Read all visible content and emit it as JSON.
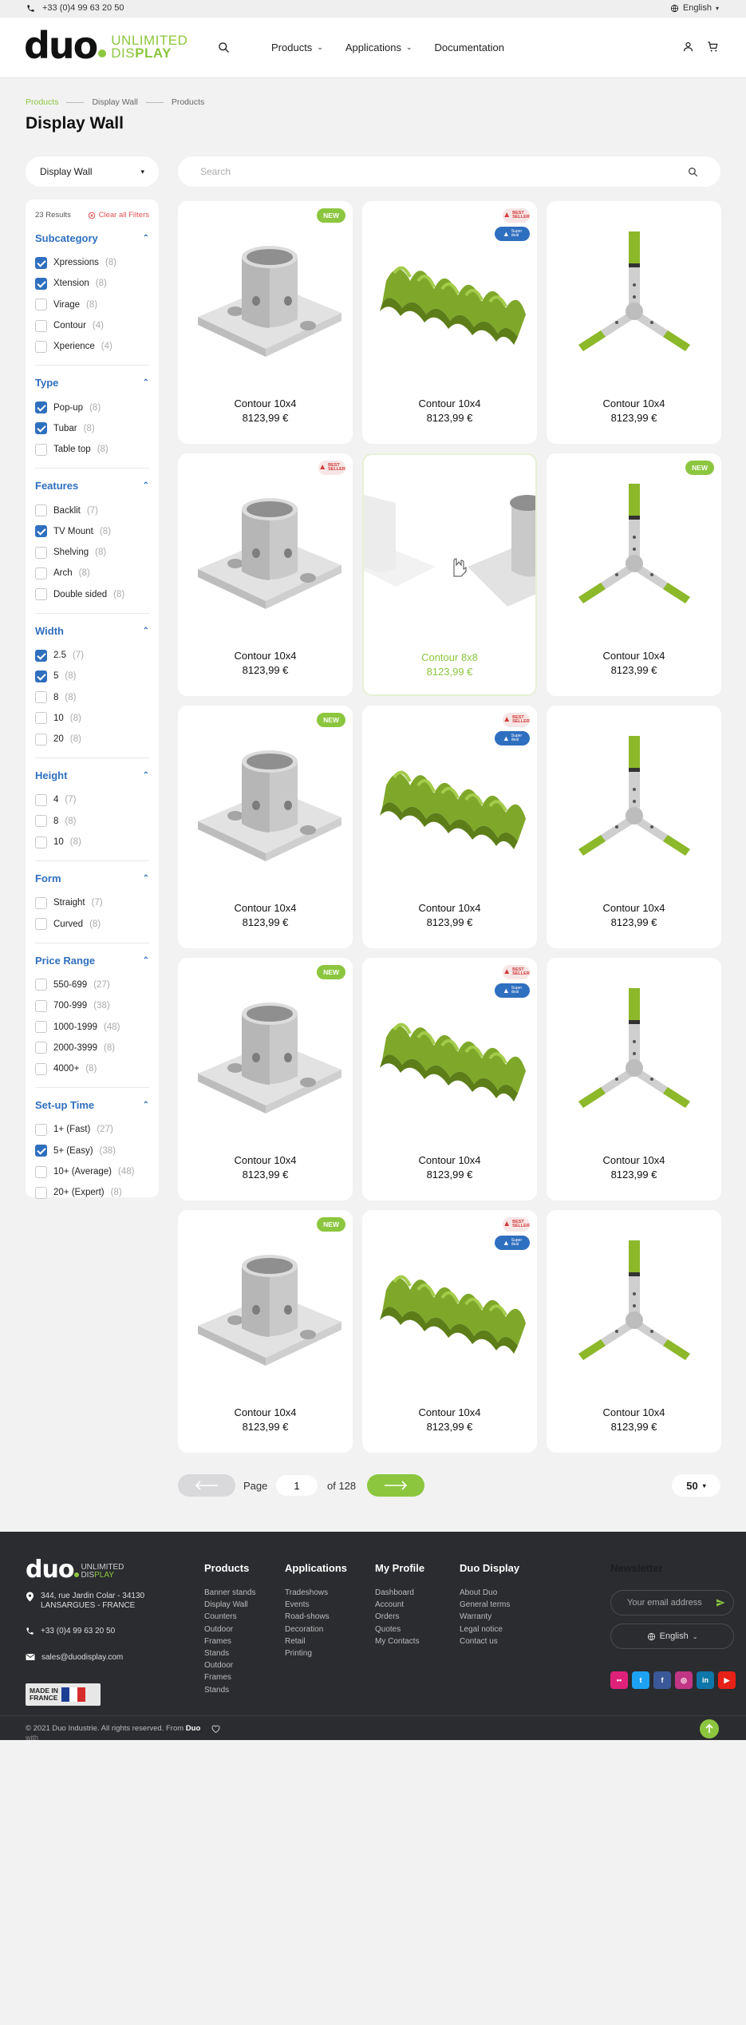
{
  "topbar": {
    "phone": "+33 (0)4 99 63 20 50",
    "language": "English"
  },
  "header": {
    "logo_main": "duo",
    "logo_line1": "UNLIMITED",
    "logo_line2a": "DIS",
    "logo_line2b": "PLAY",
    "nav": [
      {
        "label": "Products",
        "has_dropdown": true
      },
      {
        "label": "Applications",
        "has_dropdown": true
      },
      {
        "label": "Documentation",
        "has_dropdown": false
      }
    ]
  },
  "breadcrumb": [
    "Products",
    "Display Wall",
    "Products"
  ],
  "page_title": "Display Wall",
  "category_select": "Display Wall",
  "search": {
    "placeholder": "Search"
  },
  "sidebar": {
    "results": "23 Results",
    "clear": "Clear all Filters",
    "groups": [
      {
        "title": "Subcategory",
        "options": [
          {
            "label": "Xpressions",
            "count": "(8)",
            "checked": true
          },
          {
            "label": "Xtension",
            "count": "(8)",
            "checked": true
          },
          {
            "label": "Virage",
            "count": "(8)",
            "checked": false
          },
          {
            "label": "Contour",
            "count": "(4)",
            "checked": false
          },
          {
            "label": "Xperience",
            "count": "(4)",
            "checked": false
          }
        ]
      },
      {
        "title": "Type",
        "options": [
          {
            "label": "Pop-up",
            "count": "(8)",
            "checked": true
          },
          {
            "label": "Tubar",
            "count": "(8)",
            "checked": true
          },
          {
            "label": "Table top",
            "count": "(8)",
            "checked": false
          }
        ]
      },
      {
        "title": "Features",
        "options": [
          {
            "label": "Backlit",
            "count": "(7)",
            "checked": false
          },
          {
            "label": "TV Mount",
            "count": "(8)",
            "checked": true
          },
          {
            "label": "Shelving",
            "count": "(8)",
            "checked": false
          },
          {
            "label": "Arch",
            "count": "(8)",
            "checked": false
          },
          {
            "label": "Double sided",
            "count": "(8)",
            "checked": false
          }
        ]
      },
      {
        "title": "Width",
        "options": [
          {
            "label": "2.5",
            "count": "(7)",
            "checked": true
          },
          {
            "label": "5",
            "count": "(8)",
            "checked": true
          },
          {
            "label": "8",
            "count": "(8)",
            "checked": false
          },
          {
            "label": "10",
            "count": "(8)",
            "checked": false
          },
          {
            "label": "20",
            "count": "(8)",
            "checked": false
          }
        ]
      },
      {
        "title": "Height",
        "options": [
          {
            "label": "4",
            "count": "(7)",
            "checked": false
          },
          {
            "label": "8",
            "count": "(8)",
            "checked": false
          },
          {
            "label": "10",
            "count": "(8)",
            "checked": false
          }
        ]
      },
      {
        "title": "Form",
        "options": [
          {
            "label": "Straight",
            "count": "(7)",
            "checked": false
          },
          {
            "label": "Curved",
            "count": "(8)",
            "checked": false
          }
        ]
      },
      {
        "title": "Price Range",
        "options": [
          {
            "label": "550-699",
            "count": "(27)",
            "checked": false
          },
          {
            "label": "700-999",
            "count": "(38)",
            "checked": false
          },
          {
            "label": "1000-1999",
            "count": "(48)",
            "checked": false
          },
          {
            "label": "2000-3999",
            "count": "(8)",
            "checked": false
          },
          {
            "label": "4000+",
            "count": "(8)",
            "checked": false
          }
        ]
      },
      {
        "title": "Set-up Time",
        "options": [
          {
            "label": "1+ (Fast)",
            "count": "(27)",
            "checked": false
          },
          {
            "label": "5+ (Easy)",
            "count": "(38)",
            "checked": true
          },
          {
            "label": "10+ (Average)",
            "count": "(48)",
            "checked": false
          },
          {
            "label": "20+ (Expert)",
            "count": "(8)",
            "checked": false
          }
        ]
      }
    ]
  },
  "products": [
    {
      "name": "Contour 10x4",
      "price": "8123,99 €",
      "image": "foot-base",
      "badge": "new"
    },
    {
      "name": "Contour 10x4",
      "price": "8123,99 €",
      "image": "green-wave",
      "badge": "best-super"
    },
    {
      "name": "Contour 10x4",
      "price": "8123,99 €",
      "image": "connector",
      "badge": ""
    },
    {
      "name": "Contour 10x4",
      "price": "8123,99 €",
      "image": "foot-base",
      "badge": "best"
    },
    {
      "name": "Contour 8x8",
      "price": "8123,99 €",
      "image": "foot-slide",
      "badge": "",
      "hovered": true
    },
    {
      "name": "Contour 10x4",
      "price": "8123,99 €",
      "image": "connector",
      "badge": "new"
    },
    {
      "name": "Contour 10x4",
      "price": "8123,99 €",
      "image": "foot-base",
      "badge": "new"
    },
    {
      "name": "Contour 10x4",
      "price": "8123,99 €",
      "image": "green-wave",
      "badge": "best-super"
    },
    {
      "name": "Contour 10x4",
      "price": "8123,99 €",
      "image": "connector",
      "badge": ""
    },
    {
      "name": "Contour 10x4",
      "price": "8123,99 €",
      "image": "foot-base",
      "badge": "new"
    },
    {
      "name": "Contour 10x4",
      "price": "8123,99 €",
      "image": "green-wave",
      "badge": "best-super"
    },
    {
      "name": "Contour 10x4",
      "price": "8123,99 €",
      "image": "connector",
      "badge": ""
    },
    {
      "name": "Contour 10x4",
      "price": "8123,99 €",
      "image": "foot-base",
      "badge": "new"
    },
    {
      "name": "Contour 10x4",
      "price": "8123,99 €",
      "image": "green-wave",
      "badge": "best-super"
    },
    {
      "name": "Contour 10x4",
      "price": "8123,99 €",
      "image": "connector",
      "badge": ""
    }
  ],
  "badges": {
    "new": "NEW",
    "best1": "BEST",
    "best2": "SELLER",
    "super1": "Super",
    "super2": "deal"
  },
  "pagination": {
    "page_label": "Page",
    "current": "1",
    "of_label": "of 128",
    "per_page": "50"
  },
  "footer": {
    "logo_main": "duo",
    "logo_sub1": "UNLIMITED",
    "logo_sub2a": "DIS",
    "logo_sub2b": "PLAY",
    "address1": "344, rue Jardin Colar - 34130",
    "address2": "LANSARGUES - FRANCE",
    "phone": "+33 (0)4 99 63 20 50",
    "email": "sales@duodisplay.com",
    "made_in1": "MADE IN",
    "made_in2": "FRANCE",
    "columns": [
      {
        "title": "Products",
        "links": [
          "Banner stands",
          "Display Wall",
          "Counters",
          "Outdoor",
          "Frames",
          "Stands",
          "Outdoor",
          "Frames",
          "Stands"
        ]
      },
      {
        "title": "Applications",
        "links": [
          "Tradeshows",
          "Events",
          "Road-shows",
          "Decoration",
          "Retail",
          "Printing"
        ]
      },
      {
        "title": "My Profile",
        "links": [
          "Dashboard",
          "Account",
          "Orders",
          "Quotes",
          "My Contacts"
        ]
      },
      {
        "title": "Duo Display",
        "links": [
          "About Duo",
          "General terms",
          "Warranty",
          "Legal notice",
          "Contact us"
        ]
      }
    ],
    "newsletter_title": "Newsletter",
    "newsletter_placeholder": "Your email address",
    "language": "English",
    "copyright": "© 2021 Duo Industrie. All rights reserved. From",
    "copyright_brand": "Duo",
    "copyright_with": "with",
    "socials": [
      {
        "icon": "flickr-icon",
        "color": "#e0217a"
      },
      {
        "icon": "twitter-icon",
        "color": "#1da1f2"
      },
      {
        "icon": "facebook-icon",
        "color": "#3b5998"
      },
      {
        "icon": "instagram-icon",
        "color": "#c13584"
      },
      {
        "icon": "linkedin-icon",
        "color": "#0e76a8"
      },
      {
        "icon": "youtube-icon",
        "color": "#e62117"
      }
    ]
  },
  "colors": {
    "accent": "#8cc63f",
    "filter_blue": "#2f6fbf",
    "footer_bg": "#2b2c2f"
  }
}
